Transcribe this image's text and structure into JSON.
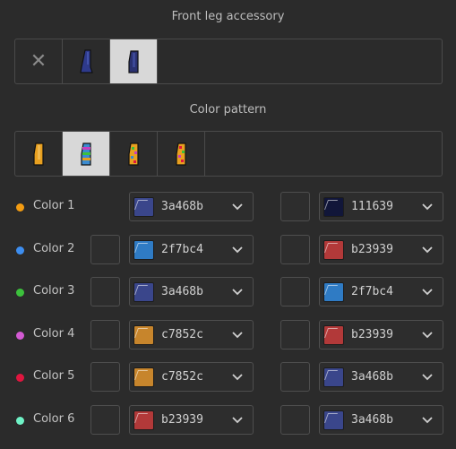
{
  "front_leg": {
    "title": "Front leg accessory",
    "tiles": [
      {
        "name": "none",
        "icon": "close-icon",
        "selected": false
      },
      {
        "name": "boot-dark-blue",
        "icon": "leg-boot-icon",
        "color": "#2e3a8c",
        "selected": false
      },
      {
        "name": "boot-dark-navy",
        "icon": "leg-boot-icon",
        "color": "#2a3170",
        "selected": true
      }
    ]
  },
  "color_pattern": {
    "title": "Color pattern",
    "tiles": [
      {
        "name": "pattern-solid",
        "selected": false
      },
      {
        "name": "pattern-striped",
        "selected": true
      },
      {
        "name": "pattern-multi-1",
        "selected": false
      },
      {
        "name": "pattern-multi-2",
        "selected": false
      }
    ]
  },
  "colors": [
    {
      "label": "Color 1",
      "dot": "#f39c12",
      "left_checkbox": false,
      "primary": {
        "hex": "3a468b",
        "color": "#3a468b"
      },
      "secondary": {
        "hex": "111639",
        "color": "#111639"
      }
    },
    {
      "label": "Color 2",
      "dot": "#3d8ef0",
      "left_checkbox": true,
      "primary": {
        "hex": "2f7bc4",
        "color": "#2f7bc4"
      },
      "secondary": {
        "hex": "b23939",
        "color": "#b23939"
      }
    },
    {
      "label": "Color 3",
      "dot": "#3cc13c",
      "left_checkbox": true,
      "primary": {
        "hex": "3a468b",
        "color": "#3a468b"
      },
      "secondary": {
        "hex": "2f7bc4",
        "color": "#2f7bc4"
      }
    },
    {
      "label": "Color 4",
      "dot": "#d35ad3",
      "left_checkbox": true,
      "primary": {
        "hex": "c7852c",
        "color": "#c7852c"
      },
      "secondary": {
        "hex": "b23939",
        "color": "#b23939"
      }
    },
    {
      "label": "Color 5",
      "dot": "#e0163f",
      "left_checkbox": true,
      "primary": {
        "hex": "c7852c",
        "color": "#c7852c"
      },
      "secondary": {
        "hex": "3a468b",
        "color": "#3a468b"
      }
    },
    {
      "label": "Color 6",
      "dot": "#6ff2c6",
      "left_checkbox": true,
      "primary": {
        "hex": "b23939",
        "color": "#b23939"
      },
      "secondary": {
        "hex": "3a468b",
        "color": "#3a468b"
      }
    }
  ]
}
